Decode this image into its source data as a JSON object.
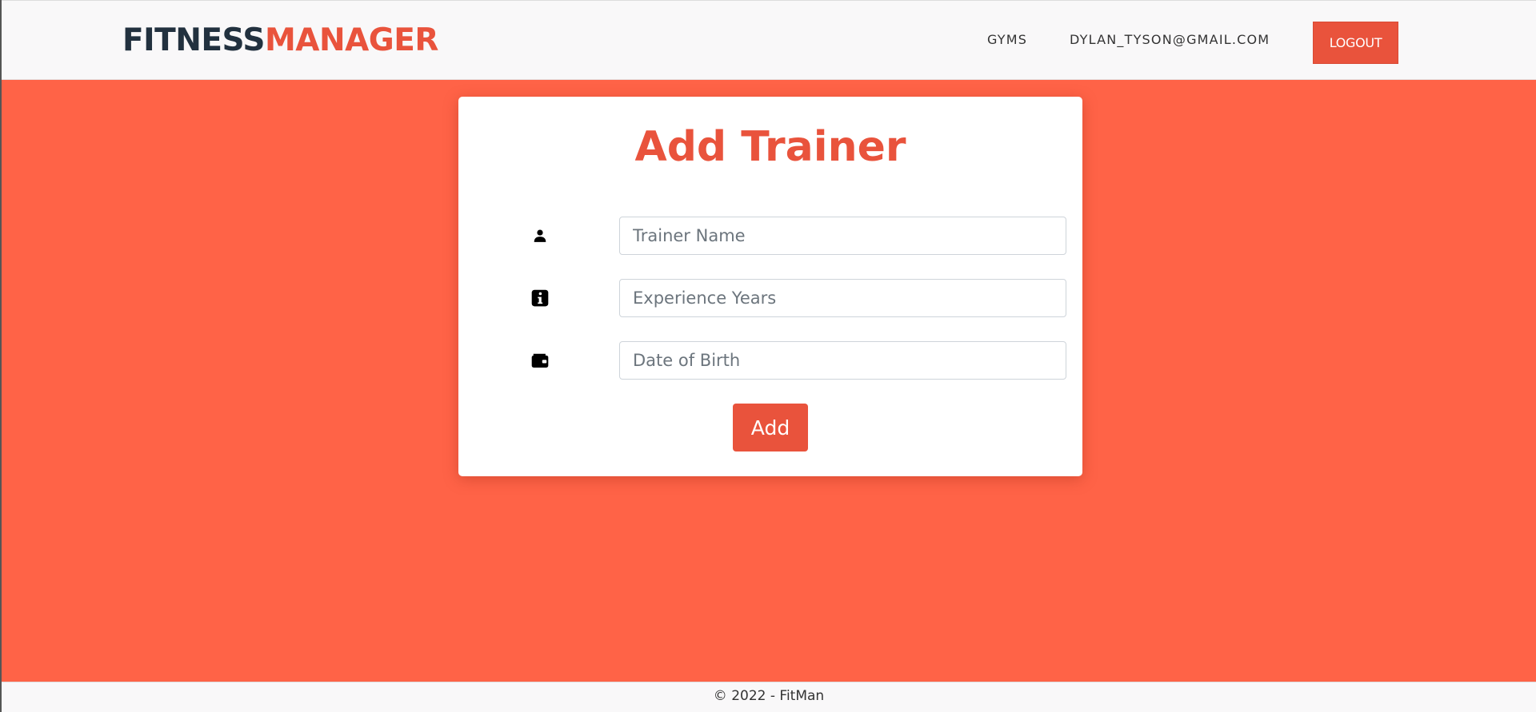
{
  "header": {
    "brand_part1": "FITNESS",
    "brand_part2": "MANAGER",
    "nav_gyms": "GYMS",
    "nav_user": "DYLAN_TYSON@GMAIL.COM",
    "logout_label": "LOGOUT"
  },
  "form": {
    "title": "Add Trainer",
    "fields": [
      {
        "icon": "user-icon",
        "placeholder": "Trainer Name",
        "value": ""
      },
      {
        "icon": "info-icon",
        "placeholder": "Experience Years",
        "value": ""
      },
      {
        "icon": "wallet-icon",
        "placeholder": "Date of Birth",
        "value": ""
      }
    ],
    "submit_label": "Add"
  },
  "footer": {
    "text": "© 2022 - FitMan"
  },
  "colors": {
    "background": "#ff6347",
    "accent": "#e9533c",
    "brand_dark": "#22313f",
    "header_bg": "#f9f8f9"
  }
}
